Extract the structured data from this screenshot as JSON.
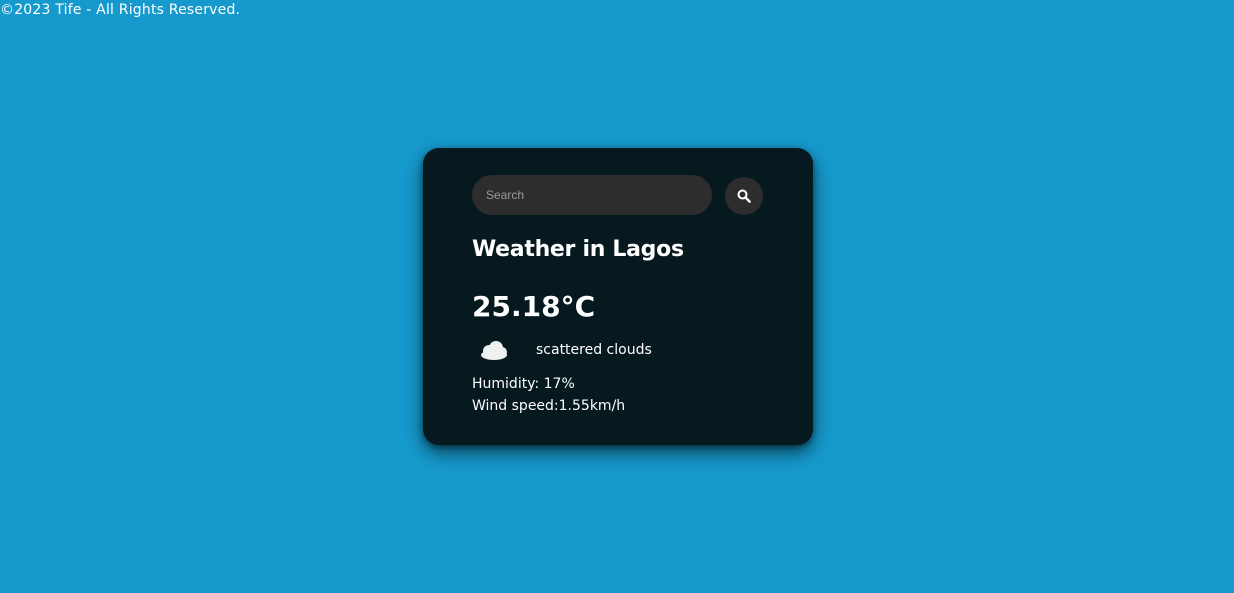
{
  "footer": {
    "copyright": "©2023 Tife - All Rights Reserved."
  },
  "search": {
    "placeholder": "Search",
    "value": "",
    "button_icon": "search-icon"
  },
  "weather": {
    "title": "Weather in Lagos",
    "temperature": "25.18°C",
    "icon": "cloud-icon",
    "description": "scattered clouds",
    "humidity": "Humidity: 17%",
    "wind_speed": "Wind speed:1.55km/h"
  },
  "colors": {
    "page_background": "#1699cc",
    "card_background": "#06191f",
    "input_background": "#2d2d2d",
    "text": "#ffffff"
  }
}
